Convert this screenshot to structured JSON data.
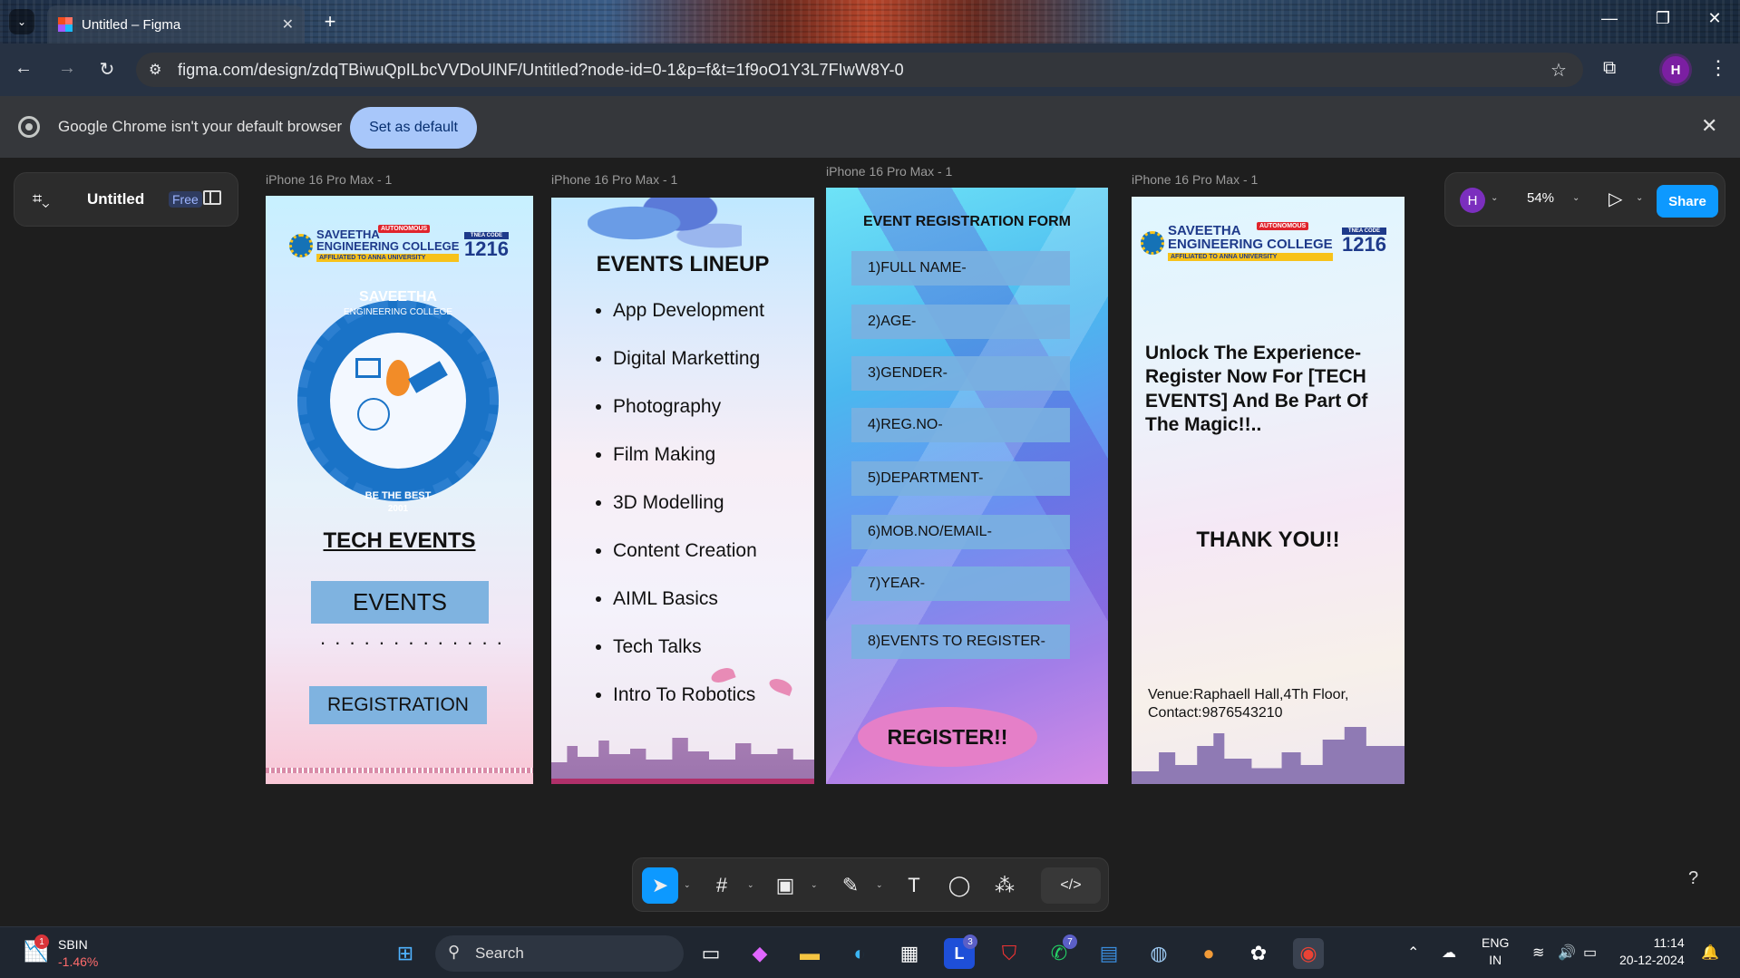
{
  "browser": {
    "tab_title": "Untitled – Figma",
    "url": "figma.com/design/zdqTBiwuQpILbcVVDoUlNF/Untitled?node-id=0-1&p=f&t=1f9oO1Y3L7FIwW8Y-0",
    "profile_initial": "H",
    "infobar_message": "Google Chrome isn't your default browser",
    "infobar_button": "Set as default"
  },
  "figma": {
    "file_name": "Untitled",
    "plan_badge": "Free",
    "user_initial": "H",
    "zoom": "54%",
    "share_label": "Share",
    "help": "?",
    "frames": [
      {
        "label": "iPhone 16 Pro Max - 1",
        "college_line1": "SAVEETHA",
        "college_line2": "ENGINEERING COLLEGE",
        "affiliated": "AFFILIATED TO ANNA UNIVERSITY",
        "autonomous": "AUTONOMOUS",
        "tnea_label": "TNEA CODE",
        "tnea_code": "1216",
        "seal_name": "SAVEETHA",
        "seal_sub": "ENGINEERING COLLEGE",
        "seal_motto": "BE THE BEST",
        "seal_year": "2001",
        "heading": "TECH EVENTS",
        "button1": "EVENTS",
        "dots": ". . . . . . . . . . . . .",
        "button2": "REGISTRATION"
      },
      {
        "label": "iPhone 16 Pro Max - 1",
        "heading": "EVENTS LINEUP",
        "items": [
          "App Development",
          "Digital Marketting",
          "Photography",
          "Film Making",
          "3D Modelling",
          "Content Creation",
          "AIML Basics",
          "Tech Talks",
          "Intro To Robotics"
        ]
      },
      {
        "label": "iPhone 16 Pro Max - 1",
        "heading": "EVENT REGISTRATION FORM",
        "fields": [
          "1)FULL NAME-",
          "2)AGE-",
          "3)GENDER-",
          "4)REG.NO-",
          "5)DEPARTMENT-",
          "6)MOB.NO/EMAIL-",
          "7)YEAR-",
          "8)EVENTS TO REGISTER-"
        ],
        "submit": "REGISTER!!"
      },
      {
        "label": "iPhone 16 Pro Max - 1",
        "college_line1": "SAVEETHA",
        "college_line2": "ENGINEERING COLLEGE",
        "affiliated": "AFFILIATED TO ANNA UNIVERSITY",
        "autonomous": "AUTONOMOUS",
        "tnea_label": "TNEA CODE",
        "tnea_code": "1216",
        "message": "Unlock The Experience- Register Now For [TECH EVENTS] And Be Part Of The Magic!!..",
        "thanks": "THANK YOU!!",
        "venue": "Venue:Raphaell Hall,4Th Floor,",
        "contact": "Contact:9876543210"
      }
    ]
  },
  "taskbar": {
    "stock_name": "SBIN",
    "stock_change": "-1.46%",
    "stock_badge": "1",
    "search_label": "Search",
    "lens_badge": "3",
    "whatsapp_badge": "7",
    "lang_line1": "ENG",
    "lang_line2": "IN",
    "time": "11:14",
    "date": "20-12-2024"
  }
}
